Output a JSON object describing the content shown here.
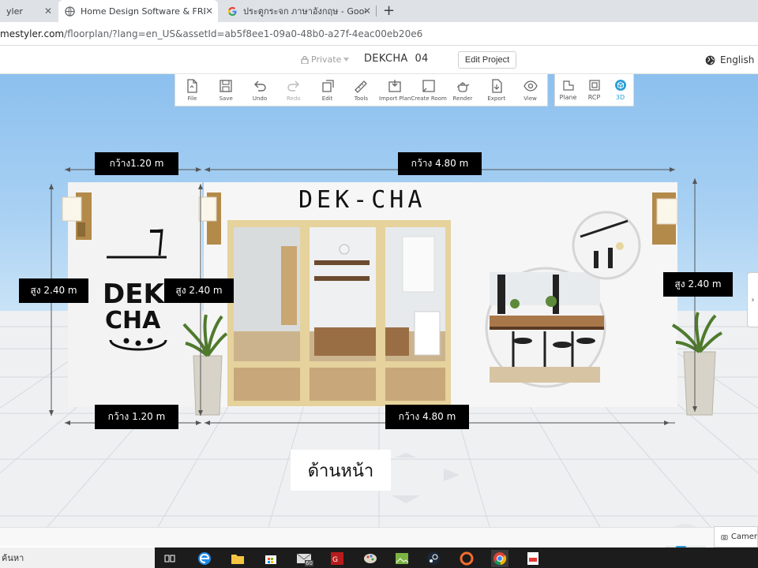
{
  "browser": {
    "tabs": [
      {
        "title": "yler",
        "active": false
      },
      {
        "title": "Home Design Software & FREE F",
        "active": true
      },
      {
        "title": "ประตูกระจก ภาษาอังกฤษ - Google Se",
        "active": false
      }
    ],
    "new_tab": "+",
    "url_host": "mestyler.com",
    "url_path": "/floorplan/?lang=en_US&assetId=ab5f8ee1-09a0-48b0-a27f-4eac00eb20e6"
  },
  "header": {
    "privacy": "Private",
    "project_name": "DEKCHA  04",
    "edit_project": "Edit Project",
    "language": "English"
  },
  "toolbar": {
    "tools": [
      {
        "label": "File",
        "icon": "file-icon"
      },
      {
        "label": "Save",
        "icon": "save-icon"
      },
      {
        "label": "Undo",
        "icon": "undo-icon"
      },
      {
        "label": "Redo",
        "icon": "redo-icon"
      },
      {
        "label": "Edit",
        "icon": "edit-icon"
      },
      {
        "label": "Tools",
        "icon": "ruler-icon"
      },
      {
        "label": "Import Plan",
        "icon": "import-plan-icon"
      },
      {
        "label": "Create Room",
        "icon": "create-room-icon"
      },
      {
        "label": "Render",
        "icon": "teapot-icon"
      },
      {
        "label": "Export",
        "icon": "export-icon"
      },
      {
        "label": "View",
        "icon": "eye-icon"
      }
    ],
    "views": [
      {
        "label": "Plane",
        "icon": "plane-icon"
      },
      {
        "label": "RCP",
        "icon": "rcp-icon"
      },
      {
        "label": "3D",
        "icon": "cube-icon"
      }
    ],
    "active_view": "3D"
  },
  "scene": {
    "sign": "DEK-CHA",
    "logo_lines": [
      "DEK",
      "CHA"
    ],
    "dimensions": {
      "top_left_width": "กว้าง1.20 m",
      "top_right_width": "กว้าง 4.80 m",
      "left_height": "สูง 2.40 m",
      "middle_height": "สูง 2.40 m",
      "right_height": "สูง 2.40 m",
      "bottom_left_width": "กว้าง 1.20 m",
      "bottom_right_width": "กว้าง 4.80 m"
    },
    "caption": "ด้านหน้า"
  },
  "status": {
    "camera": "Camer"
  },
  "taskbar": {
    "search_text": "ค้นหา",
    "badge": "60"
  },
  "colors": {
    "accent": "#2a9fd8",
    "label_bg": "#000000",
    "sky": "#a9d1f3",
    "door_frame": "#e6d29c"
  }
}
